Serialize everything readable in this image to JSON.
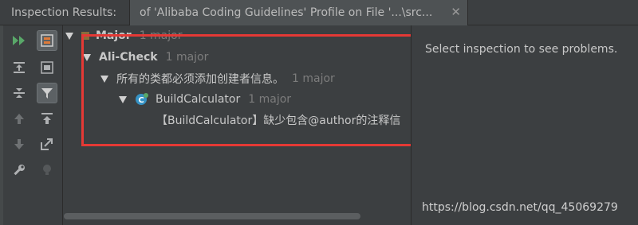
{
  "header": {
    "title": "Inspection Results:",
    "tab_label": "of 'Alibaba Coding Guidelines' Profile on File '...\\src...",
    "close_glyph": "✕"
  },
  "toolbar": {
    "buttons": [
      {
        "name": "rerun-icon",
        "active": false
      },
      {
        "name": "group-by-severity-icon",
        "active": true
      },
      {
        "name": "expand-all-icon",
        "active": false
      },
      {
        "name": "group-by-directory-icon",
        "active": false
      },
      {
        "name": "collapse-all-icon",
        "active": false
      },
      {
        "name": "filter-icon",
        "active": true
      },
      {
        "name": "previous-problem-icon",
        "active": false
      },
      {
        "name": "autoscroll-to-source-icon",
        "active": false
      },
      {
        "name": "next-problem-icon",
        "active": false
      },
      {
        "name": "export-icon",
        "active": false
      },
      {
        "name": "settings-wrench-icon",
        "active": false
      },
      {
        "name": "quick-fix-bulb-icon",
        "active": false
      }
    ]
  },
  "tree": {
    "severity": {
      "label": "Major",
      "count": "1 major"
    },
    "check": {
      "label": "Ali-Check",
      "count": "1 major"
    },
    "rule": {
      "label": "所有的类都必须添加创建者信息。",
      "count": "1 major"
    },
    "file": {
      "label": "BuildCalculator",
      "count": "1 major"
    },
    "problem": {
      "label": "【BuildCalculator】缺少包含@author的注释信"
    }
  },
  "right_pane": {
    "message": "Select inspection to see problems."
  },
  "watermark": "https://blog.csdn.net/qq_45069279",
  "colors": {
    "background": "#3c3f41",
    "highlight_border": "#e53935",
    "rerun_green": "#59a869",
    "filter_active": "#5c6164"
  }
}
